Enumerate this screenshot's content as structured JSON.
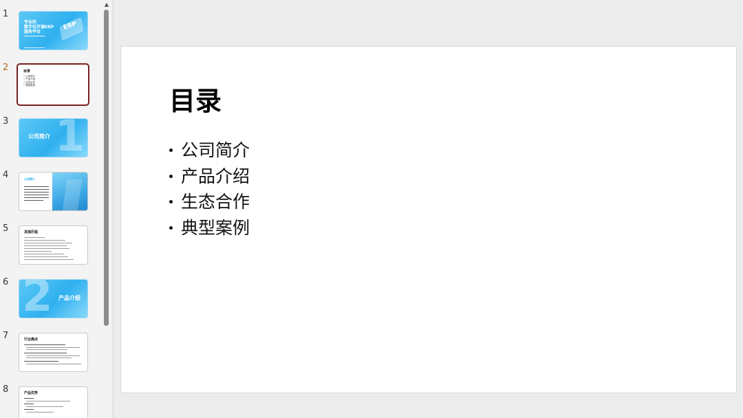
{
  "thumbnails": [
    {
      "number": "1",
      "title_lines": [
        "专业的",
        "数字化开源ERP",
        "服务平台"
      ],
      "badge": "ERP"
    },
    {
      "number": "2",
      "title": "目录",
      "items": [
        "公司简介",
        "产品介绍",
        "生态合作",
        "典型案例"
      ]
    },
    {
      "number": "3",
      "title": "公司简介",
      "big_numeral": "1"
    },
    {
      "number": "4",
      "title": "公司简介"
    },
    {
      "number": "5",
      "title": "发展历程"
    },
    {
      "number": "6",
      "title": "产品介绍",
      "big_numeral": "2"
    },
    {
      "number": "7",
      "title": "行业痛点"
    },
    {
      "number": "8",
      "title": "产品优势"
    }
  ],
  "slide": {
    "title": "目录",
    "bullets": [
      "公司简介",
      "产品介绍",
      "生态合作",
      "典型案例"
    ]
  },
  "colors": {
    "selected_border": "#7a1f1f",
    "active_number": "#b5651d",
    "accent_blue": "#2fb0ef"
  }
}
